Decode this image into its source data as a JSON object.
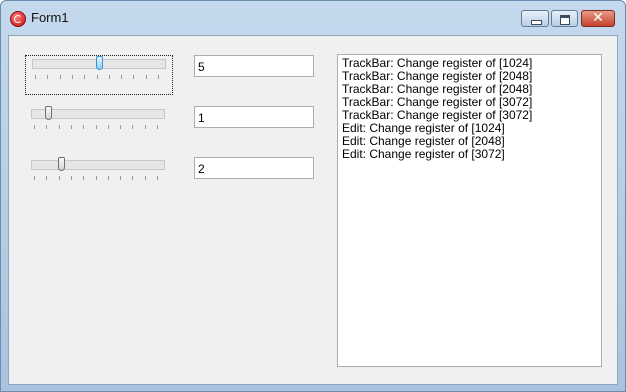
{
  "window": {
    "title": "Form1"
  },
  "trackbars": [
    {
      "value": 5,
      "max": 10
    },
    {
      "value": 1,
      "max": 10
    },
    {
      "value": 2,
      "max": 10
    }
  ],
  "edits": [
    {
      "value": "5"
    },
    {
      "value": "1"
    },
    {
      "value": "2"
    }
  ],
  "memo": {
    "lines": [
      "TrackBar: Change register of [1024]",
      "TrackBar: Change register of [2048]",
      "TrackBar: Change register of [2048]",
      "TrackBar: Change register of [3072]",
      "TrackBar: Change register of [3072]",
      "Edit: Change register of [1024]",
      "Edit: Change register of [2048]",
      "Edit: Change register of [3072]"
    ]
  }
}
